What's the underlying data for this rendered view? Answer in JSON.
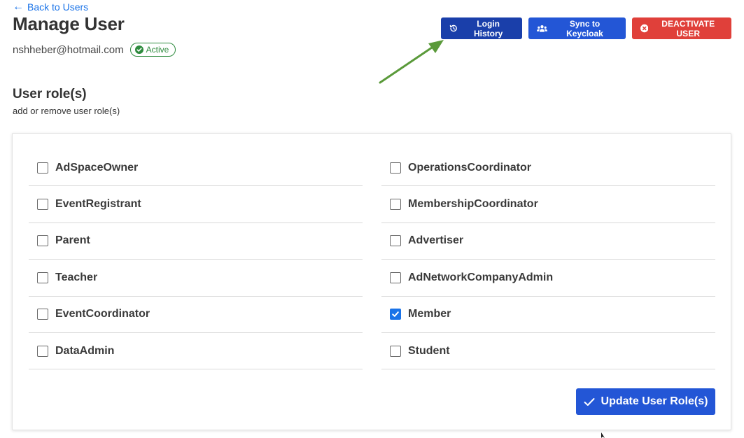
{
  "nav": {
    "back_label": "Back to Users"
  },
  "header": {
    "title": "Manage User",
    "email": "nshheber@hotmail.com",
    "status": "Active"
  },
  "actions": {
    "login_history": "Login History",
    "sync": "Sync to Keycloak",
    "deactivate": "DEACTIVATE USER"
  },
  "roles_section": {
    "title": "User role(s)",
    "subtitle": "add or remove user role(s)",
    "left": [
      {
        "label": "AdSpaceOwner",
        "checked": false
      },
      {
        "label": "EventRegistrant",
        "checked": false
      },
      {
        "label": "Parent",
        "checked": false
      },
      {
        "label": "Teacher",
        "checked": false
      },
      {
        "label": "EventCoordinator",
        "checked": false
      },
      {
        "label": "DataAdmin",
        "checked": false
      }
    ],
    "right": [
      {
        "label": "OperationsCoordinator",
        "checked": false
      },
      {
        "label": "MembershipCoordinator",
        "checked": false
      },
      {
        "label": "Advertiser",
        "checked": false
      },
      {
        "label": "AdNetworkCompanyAdmin",
        "checked": false
      },
      {
        "label": "Member",
        "checked": true
      },
      {
        "label": "Student",
        "checked": false
      }
    ],
    "update_label": "Update User Role(s)"
  },
  "colors": {
    "link": "#1a73e8",
    "login_button": "#1a3faa",
    "primary_button": "#2356d6",
    "danger_button": "#e0403a",
    "active_badge": "#2e8b3e",
    "annotation_arrow": "#5a9a3a"
  },
  "icons": {
    "back": "arrow-left-icon",
    "status": "check-circle-icon",
    "login_history": "history-icon",
    "sync": "users-icon",
    "deactivate": "close-circle-icon",
    "update": "checkmark-icon"
  }
}
